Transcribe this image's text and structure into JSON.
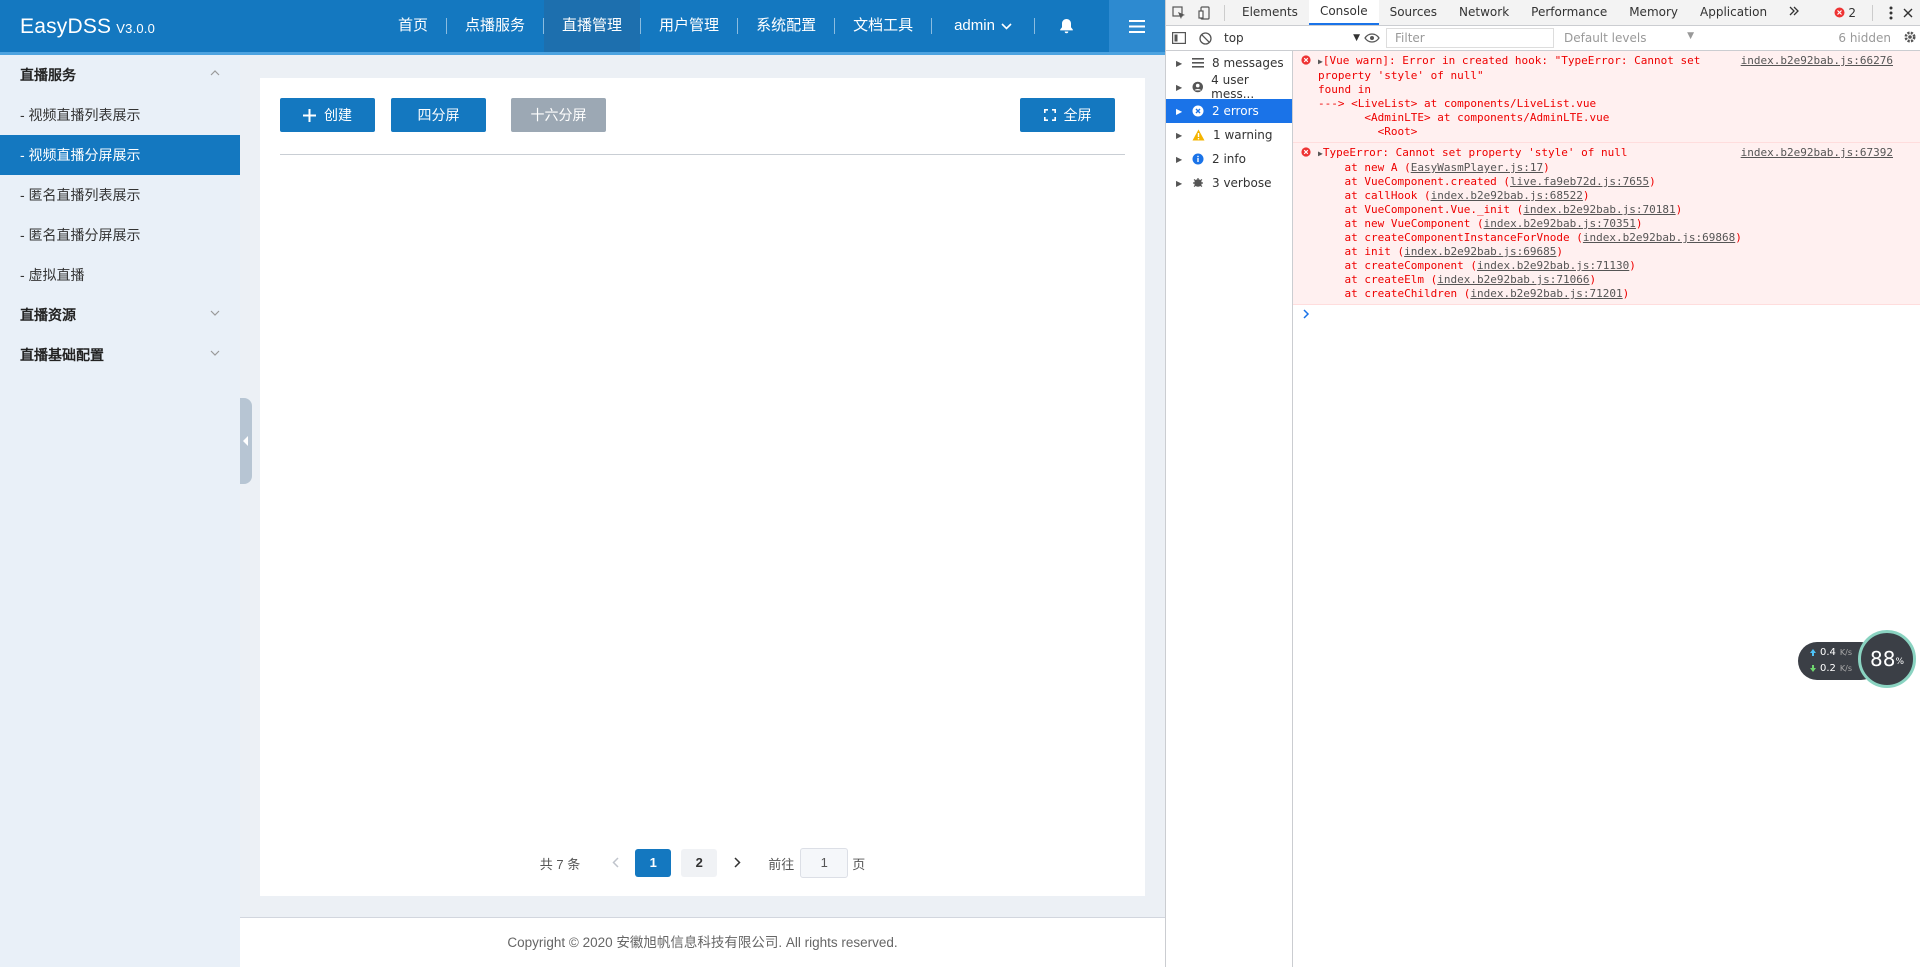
{
  "app": {
    "brand": "EasyDSS",
    "version": "V3.0.0",
    "nav": [
      "首页",
      "点播服务",
      "直播管理",
      "用户管理",
      "系统配置",
      "文档工具"
    ],
    "user": "admin",
    "sidebar": {
      "group1": "直播服务",
      "items": [
        "- 视频直播列表展示",
        "- 视频直播分屏展示",
        "- 匿名直播列表展示",
        "- 匿名直播分屏展示",
        "- 虚拟直播"
      ],
      "group2": "直播资源",
      "group3": "直播基础配置"
    },
    "toolbar": {
      "create": "创建",
      "quad": "四分屏",
      "sixteen": "十六分屏",
      "fullscreen": "全屏"
    },
    "pager": {
      "total": "共 7 条",
      "pages": [
        "1",
        "2"
      ],
      "goto_label": "前往",
      "goto_value": "1",
      "goto_suffix": "页"
    },
    "footer": "Copyright © 2020 安徽旭帆信息科技有限公司. All rights reserved."
  },
  "devtools": {
    "tabs": [
      "Elements",
      "Console",
      "Sources",
      "Network",
      "Performance",
      "Memory",
      "Application"
    ],
    "error_badge": "2",
    "context": "top",
    "filter_placeholder": "Filter",
    "levels": "Default levels",
    "hidden": "6 hidden",
    "sidebar": [
      "8 messages",
      "4 user mess...",
      "2 errors",
      "1 warning",
      "2 info",
      "3 verbose"
    ],
    "log1": {
      "source": "index.b2e92bab.js:66276",
      "lines": [
        "[Vue warn]: Error in created hook: \"TypeError: Cannot set",
        "property 'style' of null\"",
        "",
        "found in",
        "",
        "---> <LiveList> at components/LiveList.vue",
        "       <AdminLTE> at components/AdminLTE.vue",
        "         <Root>"
      ]
    },
    "log2": {
      "source": "index.b2e92bab.js:67392",
      "head": "TypeError: Cannot set property 'style' of null",
      "stack": [
        {
          "fn": "    at new A (",
          "link": "EasyWasmPlayer.js:17"
        },
        {
          "fn": "    at VueComponent.created (",
          "link": "live.fa9eb72d.js:7655"
        },
        {
          "fn": "    at callHook (",
          "link": "index.b2e92bab.js:68522"
        },
        {
          "fn": "    at VueComponent.Vue._init (",
          "link": "index.b2e92bab.js:70181"
        },
        {
          "fn": "    at new VueComponent (",
          "link": "index.b2e92bab.js:70351"
        },
        {
          "fn": "    at createComponentInstanceForVnode (",
          "link": "index.b2e92bab.js:69868"
        },
        {
          "fn": "    at init (",
          "link": "index.b2e92bab.js:69685"
        },
        {
          "fn": "    at createComponent (",
          "link": "index.b2e92bab.js:71130"
        },
        {
          "fn": "    at createElm (",
          "link": "index.b2e92bab.js:71066"
        },
        {
          "fn": "    at createChildren (",
          "link": "index.b2e92bab.js:71201"
        }
      ]
    }
  },
  "net_widget": {
    "up": "0.4",
    "down": "0.2",
    "unit": "K/s",
    "percent": "88",
    "percent_unit": "%"
  }
}
